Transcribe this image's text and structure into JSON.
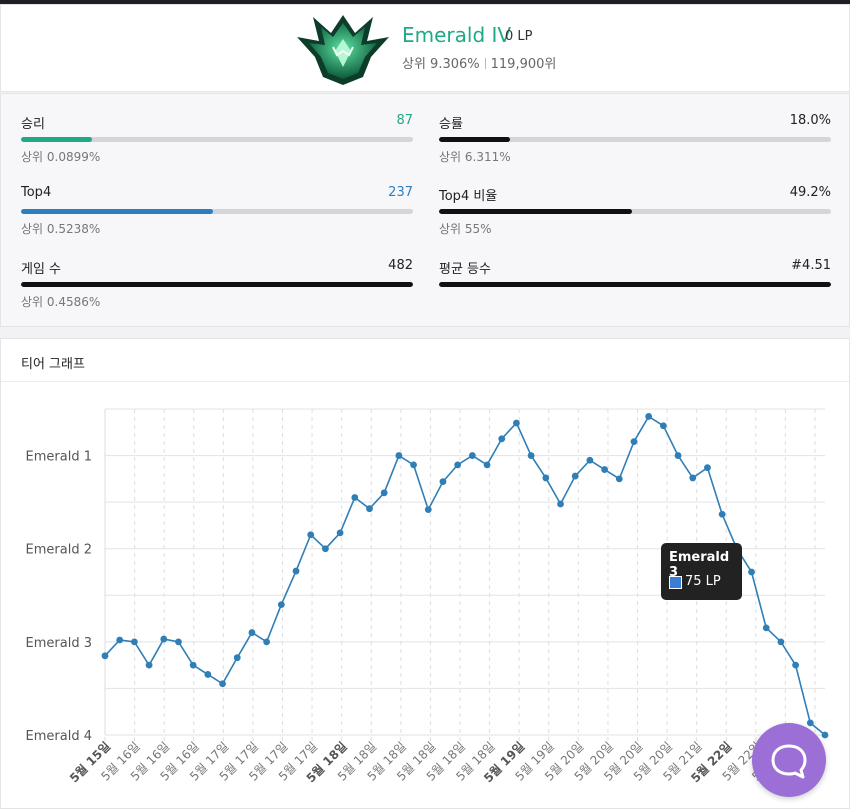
{
  "rank": {
    "tier": "Emerald IV",
    "lp": "0 LP",
    "top_percent": "상위 9.306%",
    "ladder_rank": "119,900위",
    "emblem_icon": "emerald-emblem-icon",
    "tier_color": "#1fa987"
  },
  "stats": [
    {
      "label": "승리",
      "value": "87",
      "sub": "상위 0.0899%",
      "fill": 0.18,
      "color": "#1fa987",
      "value_color": "#1fa987"
    },
    {
      "label": "승률",
      "value": "18.0%",
      "sub": "상위 6.311%",
      "fill": 0.18,
      "color": "#111111",
      "value_color": "#222222"
    },
    {
      "label": "Top4",
      "value": "237",
      "sub": "상위 0.5238%",
      "fill": 0.49,
      "color": "#2b7fc0",
      "value_color": "#2b7fc0"
    },
    {
      "label": "Top4 비율",
      "value": "49.2%",
      "sub": "상위 55%",
      "fill": 0.492,
      "color": "#111111",
      "value_color": "#222222"
    },
    {
      "label": "게임 수",
      "value": "482",
      "sub": "상위 0.4586%",
      "fill": 1.0,
      "color": "#111111",
      "value_color": "#222222"
    },
    {
      "label": "평균 등수",
      "value": "#4.51",
      "sub": "",
      "fill": 1.0,
      "color": "#111111",
      "value_color": "#222222"
    }
  ],
  "graph": {
    "title": "티어 그래프",
    "tooltip": {
      "title": "Emerald 3",
      "value": "75 LP",
      "swatch_color": "#3a7dd2"
    },
    "chat_icon": "chat-bubble-icon"
  },
  "chart_data": {
    "type": "line",
    "line_color": "#2f7fb6",
    "y_ticks": [
      "Emerald 4",
      "Emerald 3",
      "Emerald 2",
      "Emerald 1"
    ],
    "ylim": [
      0,
      350
    ],
    "x_labels": [
      "5월 15일",
      "5월 16일",
      "5월 16일",
      "5월 16일",
      "5월 17일",
      "5월 17일",
      "5월 17일",
      "5월 17일",
      "5월 18일",
      "5월 18일",
      "5월 18일",
      "5월 18일",
      "5월 18일",
      "5월 18일",
      "5월 19일",
      "5월 19일",
      "5월 20일",
      "5월 20일",
      "5월 20일",
      "5월 20일",
      "5월 21일",
      "5월 22일",
      "5월 22일",
      "5월 22일",
      "5월 22일"
    ],
    "bold_labels": [
      "5월 15일",
      "5월 18일",
      "5월 19일",
      "5월 22일"
    ],
    "values": [
      85,
      102,
      100,
      75,
      103,
      100,
      75,
      65,
      55,
      83,
      110,
      100,
      140,
      176,
      215,
      200,
      217,
      255,
      243,
      260,
      300,
      290,
      242,
      272,
      290,
      300,
      290,
      318,
      335,
      300,
      276,
      248,
      278,
      295,
      285,
      275,
      315,
      342,
      332,
      300,
      276,
      287,
      237,
      200,
      175,
      115,
      100,
      75,
      13,
      0
    ]
  }
}
